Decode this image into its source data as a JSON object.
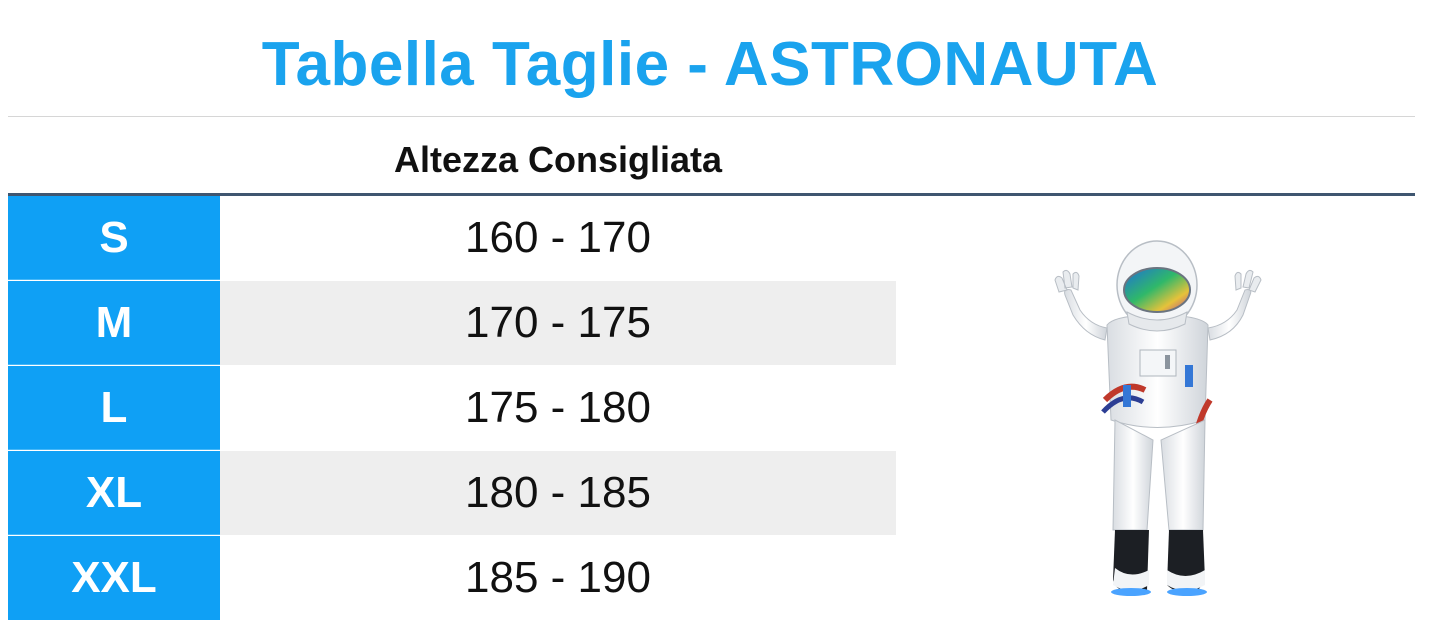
{
  "title": "Tabella Taglie - ASTRONAUTA",
  "column_header": "Altezza Consigliata",
  "rows": [
    {
      "size": "S",
      "height": "160 - 170"
    },
    {
      "size": "M",
      "height": "170 - 175"
    },
    {
      "size": "L",
      "height": "175 - 180"
    },
    {
      "size": "XL",
      "height": "180 - 185"
    },
    {
      "size": "XXL",
      "height": "185 - 190"
    }
  ],
  "colors": {
    "accent": "#1aa3ee",
    "size_cell": "#0fa0f5",
    "header_rule": "#3f5670",
    "alt_row": "#eeeeee"
  },
  "image": {
    "icon": "astronaut-costume-icon"
  }
}
